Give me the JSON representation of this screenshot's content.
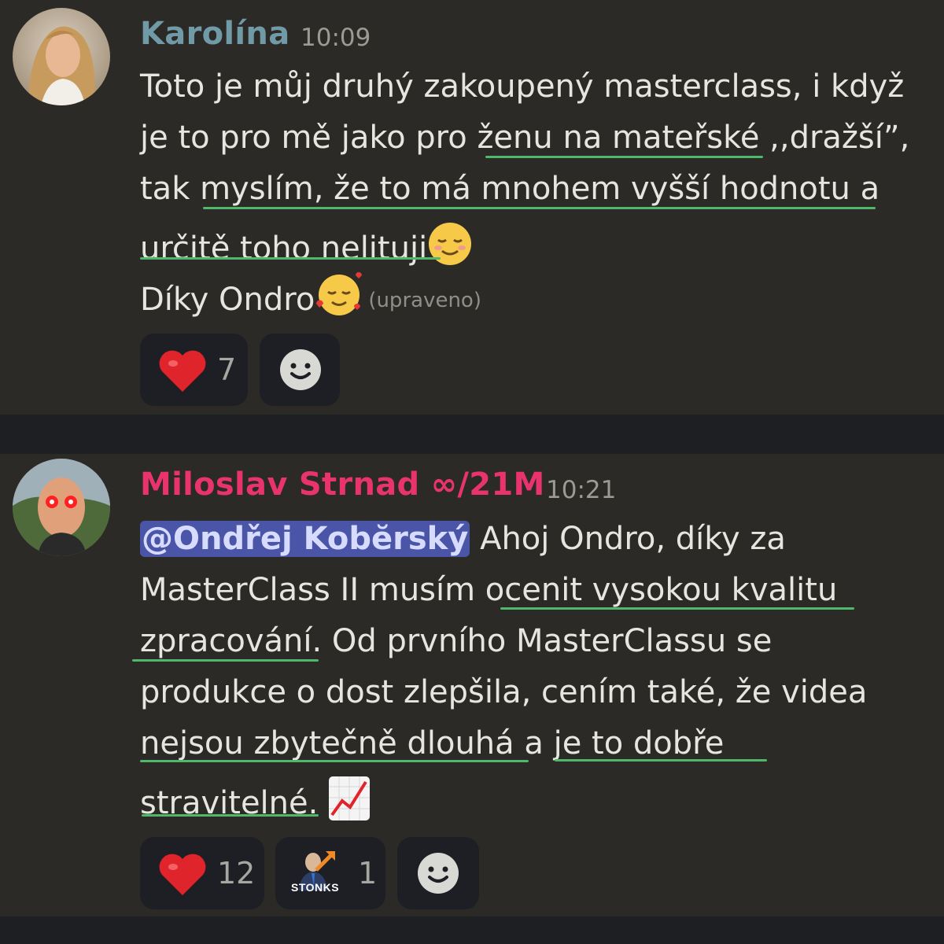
{
  "messages": [
    {
      "author": "Karolína",
      "author_color": "#6f9aa6",
      "time": "10:09",
      "lines": [
        "Toto je můj druhý zakoupený masterclass, i když",
        "je to pro mě jako pro ženu na mateřské ,,dražší”,",
        "tak myslím, že to má mnohem vyšší hodnotu a",
        "určitě toho nelituji",
        "Díky Ondro"
      ],
      "edited_label": "(upraveno)",
      "reactions": [
        {
          "emoji": "heart-icon",
          "count": "7"
        }
      ]
    },
    {
      "author": "Miloslav Strnad ∞/21M",
      "author_color": "#e8336f",
      "time": "10:21",
      "mention": "@Ondřej Kobĕrský",
      "lines": [
        "Ahoj Ondro, díky za",
        "MasterClass II musím ocenit vysokou kvalitu",
        "zpracování. Od prvního MasterClassu se",
        "produkce o dost zlepšila, cením také, že videa",
        "nejsou zbytečně dlouhá a je to dobře",
        "stravitelné."
      ],
      "reactions": [
        {
          "emoji": "heart-icon",
          "count": "12"
        },
        {
          "emoji": "stonks-icon",
          "label": "STONKS",
          "count": "1"
        }
      ]
    }
  ],
  "colors": {
    "underline": "#4fb86a",
    "mention_bg": "#4a55a8",
    "message_bg": "#2b2a26",
    "separator_bg": "#1e1f22"
  }
}
